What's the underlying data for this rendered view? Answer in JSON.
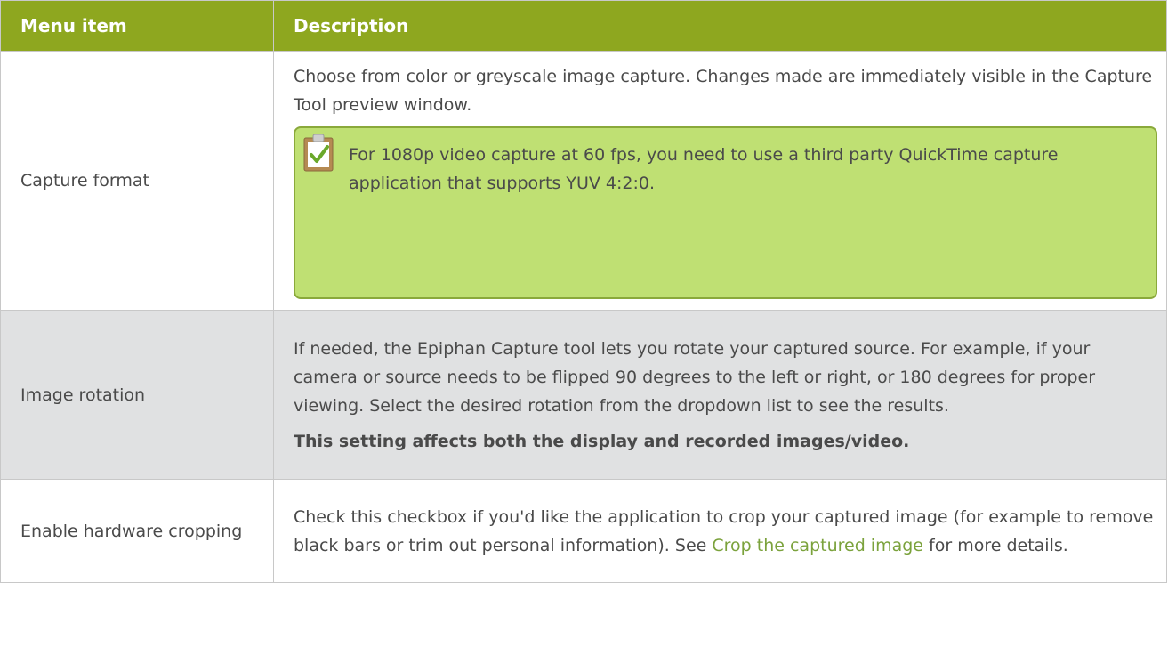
{
  "table": {
    "headers": [
      "Menu item",
      "Description"
    ],
    "rows": [
      {
        "item": "Capture format",
        "desc": "Choose from color or greyscale image capture. Changes made are immediately visible in the Capture Tool preview window.",
        "note": "For 1080p video capture at 60 fps, you need to use a third party QuickTime capture application that supports YUV 4:2:0.",
        "note_icon": "clipboard-check-icon"
      },
      {
        "item": "Image rotation",
        "desc": "If needed, the Epiphan Capture tool lets you rotate your captured source. For example, if your camera or source needs to be flipped 90 degrees to the left or right, or 180 degrees for proper viewing. Select the desired rotation from the dropdown list to see the results.",
        "emphasis": "This setting affects both the display and recorded images/video."
      },
      {
        "item": "Enable hardware cropping",
        "desc_before": "Check this checkbox if you'd like the application to crop your captured image (for example to remove black bars or trim out personal information). See ",
        "link": "Crop the captured image",
        "desc_after": " for more details."
      }
    ]
  },
  "colors": {
    "header_bg": "#8ea71f",
    "note_bg": "#bfe073",
    "link": "#7ba23c",
    "shaded_row": "#e0e1e2"
  }
}
